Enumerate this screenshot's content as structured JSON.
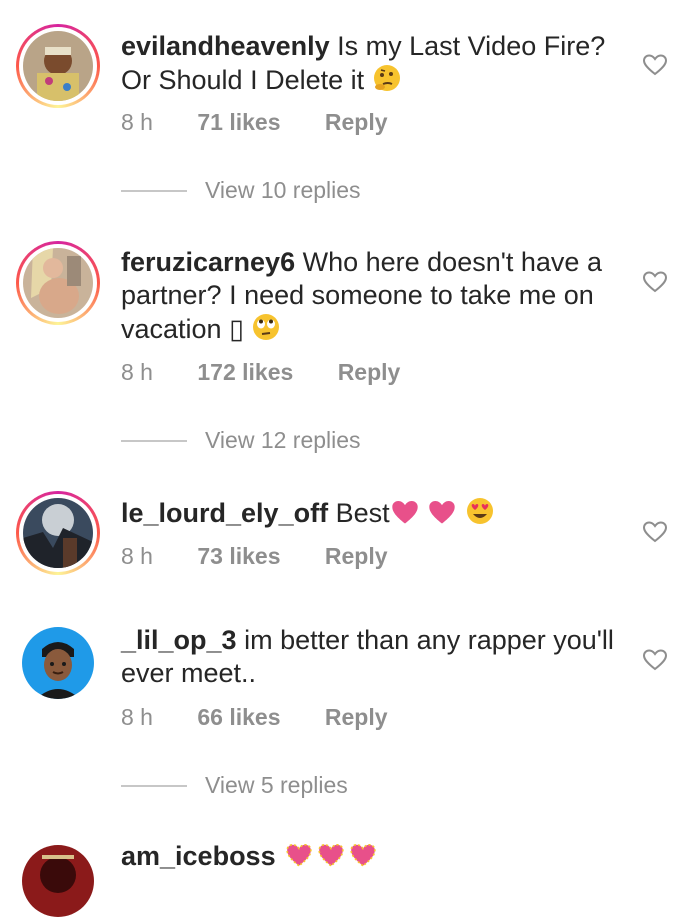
{
  "comments": [
    {
      "username": "evilandheavenly",
      "text": "Is my Last Video Fire? Or Should I Delete it",
      "emojis": [
        "thinking-face"
      ],
      "time": "8 h",
      "likes": "71 likes",
      "reply": "Reply",
      "view_replies": "View 10 replies",
      "ring": true
    },
    {
      "username": "feruzicarney6",
      "text": "Who here doesn't have a partner? I need someone to take me on vacation ▯",
      "emojis": [
        "rolling-eyes-face"
      ],
      "time": "8 h",
      "likes": "172 likes",
      "reply": "Reply",
      "view_replies": "View 12 replies",
      "ring": true
    },
    {
      "username": "le_lourd_ely_off",
      "text": "Best",
      "emojis": [
        "pink-heart",
        "pink-heart",
        "heart-eyes-face"
      ],
      "time": "8 h",
      "likes": "73 likes",
      "reply": "Reply",
      "ring": true
    },
    {
      "username": "_lil_op_3",
      "text": "im better than any rapper you'll ever meet..",
      "emojis": [],
      "time": "8 h",
      "likes": "66 likes",
      "reply": "Reply",
      "view_replies": "View 5 replies",
      "ring": false
    },
    {
      "username": "am_iceboss",
      "text": "",
      "emojis": [
        "sparkling-heart",
        "sparkling-heart",
        "sparkling-heart"
      ],
      "ring": false
    }
  ],
  "colors": {
    "meta": "#8e8e8e",
    "text": "#262626",
    "heart_emoji": "#e8508a"
  }
}
